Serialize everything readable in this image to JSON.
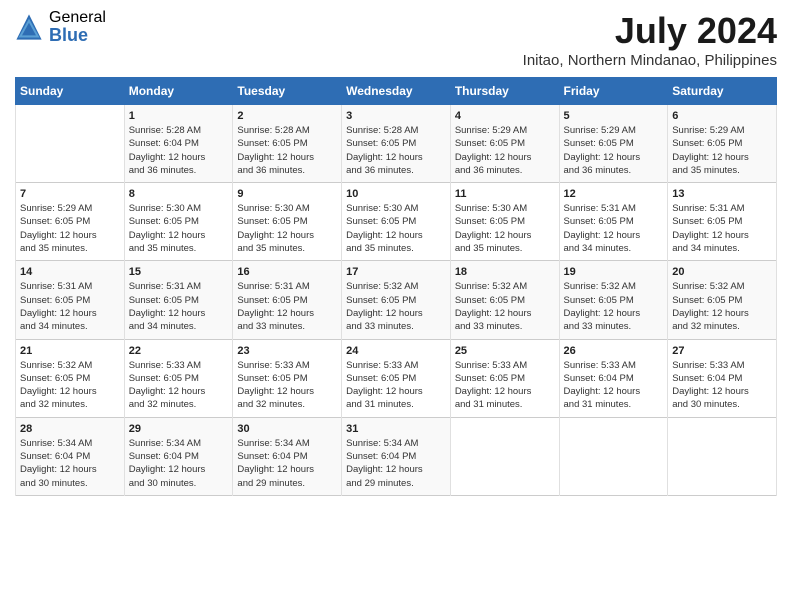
{
  "header": {
    "logo_general": "General",
    "logo_blue": "Blue",
    "month_year": "July 2024",
    "location": "Initao, Northern Mindanao, Philippines"
  },
  "weekdays": [
    "Sunday",
    "Monday",
    "Tuesday",
    "Wednesday",
    "Thursday",
    "Friday",
    "Saturday"
  ],
  "weeks": [
    [
      {
        "day": "",
        "sunrise": "",
        "sunset": "",
        "daylight": ""
      },
      {
        "day": "1",
        "sunrise": "Sunrise: 5:28 AM",
        "sunset": "Sunset: 6:04 PM",
        "daylight": "Daylight: 12 hours and 36 minutes."
      },
      {
        "day": "2",
        "sunrise": "Sunrise: 5:28 AM",
        "sunset": "Sunset: 6:05 PM",
        "daylight": "Daylight: 12 hours and 36 minutes."
      },
      {
        "day": "3",
        "sunrise": "Sunrise: 5:28 AM",
        "sunset": "Sunset: 6:05 PM",
        "daylight": "Daylight: 12 hours and 36 minutes."
      },
      {
        "day": "4",
        "sunrise": "Sunrise: 5:29 AM",
        "sunset": "Sunset: 6:05 PM",
        "daylight": "Daylight: 12 hours and 36 minutes."
      },
      {
        "day": "5",
        "sunrise": "Sunrise: 5:29 AM",
        "sunset": "Sunset: 6:05 PM",
        "daylight": "Daylight: 12 hours and 36 minutes."
      },
      {
        "day": "6",
        "sunrise": "Sunrise: 5:29 AM",
        "sunset": "Sunset: 6:05 PM",
        "daylight": "Daylight: 12 hours and 35 minutes."
      }
    ],
    [
      {
        "day": "7",
        "sunrise": "Sunrise: 5:29 AM",
        "sunset": "Sunset: 6:05 PM",
        "daylight": "Daylight: 12 hours and 35 minutes."
      },
      {
        "day": "8",
        "sunrise": "Sunrise: 5:30 AM",
        "sunset": "Sunset: 6:05 PM",
        "daylight": "Daylight: 12 hours and 35 minutes."
      },
      {
        "day": "9",
        "sunrise": "Sunrise: 5:30 AM",
        "sunset": "Sunset: 6:05 PM",
        "daylight": "Daylight: 12 hours and 35 minutes."
      },
      {
        "day": "10",
        "sunrise": "Sunrise: 5:30 AM",
        "sunset": "Sunset: 6:05 PM",
        "daylight": "Daylight: 12 hours and 35 minutes."
      },
      {
        "day": "11",
        "sunrise": "Sunrise: 5:30 AM",
        "sunset": "Sunset: 6:05 PM",
        "daylight": "Daylight: 12 hours and 35 minutes."
      },
      {
        "day": "12",
        "sunrise": "Sunrise: 5:31 AM",
        "sunset": "Sunset: 6:05 PM",
        "daylight": "Daylight: 12 hours and 34 minutes."
      },
      {
        "day": "13",
        "sunrise": "Sunrise: 5:31 AM",
        "sunset": "Sunset: 6:05 PM",
        "daylight": "Daylight: 12 hours and 34 minutes."
      }
    ],
    [
      {
        "day": "14",
        "sunrise": "Sunrise: 5:31 AM",
        "sunset": "Sunset: 6:05 PM",
        "daylight": "Daylight: 12 hours and 34 minutes."
      },
      {
        "day": "15",
        "sunrise": "Sunrise: 5:31 AM",
        "sunset": "Sunset: 6:05 PM",
        "daylight": "Daylight: 12 hours and 34 minutes."
      },
      {
        "day": "16",
        "sunrise": "Sunrise: 5:31 AM",
        "sunset": "Sunset: 6:05 PM",
        "daylight": "Daylight: 12 hours and 33 minutes."
      },
      {
        "day": "17",
        "sunrise": "Sunrise: 5:32 AM",
        "sunset": "Sunset: 6:05 PM",
        "daylight": "Daylight: 12 hours and 33 minutes."
      },
      {
        "day": "18",
        "sunrise": "Sunrise: 5:32 AM",
        "sunset": "Sunset: 6:05 PM",
        "daylight": "Daylight: 12 hours and 33 minutes."
      },
      {
        "day": "19",
        "sunrise": "Sunrise: 5:32 AM",
        "sunset": "Sunset: 6:05 PM",
        "daylight": "Daylight: 12 hours and 33 minutes."
      },
      {
        "day": "20",
        "sunrise": "Sunrise: 5:32 AM",
        "sunset": "Sunset: 6:05 PM",
        "daylight": "Daylight: 12 hours and 32 minutes."
      }
    ],
    [
      {
        "day": "21",
        "sunrise": "Sunrise: 5:32 AM",
        "sunset": "Sunset: 6:05 PM",
        "daylight": "Daylight: 12 hours and 32 minutes."
      },
      {
        "day": "22",
        "sunrise": "Sunrise: 5:33 AM",
        "sunset": "Sunset: 6:05 PM",
        "daylight": "Daylight: 12 hours and 32 minutes."
      },
      {
        "day": "23",
        "sunrise": "Sunrise: 5:33 AM",
        "sunset": "Sunset: 6:05 PM",
        "daylight": "Daylight: 12 hours and 32 minutes."
      },
      {
        "day": "24",
        "sunrise": "Sunrise: 5:33 AM",
        "sunset": "Sunset: 6:05 PM",
        "daylight": "Daylight: 12 hours and 31 minutes."
      },
      {
        "day": "25",
        "sunrise": "Sunrise: 5:33 AM",
        "sunset": "Sunset: 6:05 PM",
        "daylight": "Daylight: 12 hours and 31 minutes."
      },
      {
        "day": "26",
        "sunrise": "Sunrise: 5:33 AM",
        "sunset": "Sunset: 6:04 PM",
        "daylight": "Daylight: 12 hours and 31 minutes."
      },
      {
        "day": "27",
        "sunrise": "Sunrise: 5:33 AM",
        "sunset": "Sunset: 6:04 PM",
        "daylight": "Daylight: 12 hours and 30 minutes."
      }
    ],
    [
      {
        "day": "28",
        "sunrise": "Sunrise: 5:34 AM",
        "sunset": "Sunset: 6:04 PM",
        "daylight": "Daylight: 12 hours and 30 minutes."
      },
      {
        "day": "29",
        "sunrise": "Sunrise: 5:34 AM",
        "sunset": "Sunset: 6:04 PM",
        "daylight": "Daylight: 12 hours and 30 minutes."
      },
      {
        "day": "30",
        "sunrise": "Sunrise: 5:34 AM",
        "sunset": "Sunset: 6:04 PM",
        "daylight": "Daylight: 12 hours and 29 minutes."
      },
      {
        "day": "31",
        "sunrise": "Sunrise: 5:34 AM",
        "sunset": "Sunset: 6:04 PM",
        "daylight": "Daylight: 12 hours and 29 minutes."
      },
      {
        "day": "",
        "sunrise": "",
        "sunset": "",
        "daylight": ""
      },
      {
        "day": "",
        "sunrise": "",
        "sunset": "",
        "daylight": ""
      },
      {
        "day": "",
        "sunrise": "",
        "sunset": "",
        "daylight": ""
      }
    ]
  ]
}
